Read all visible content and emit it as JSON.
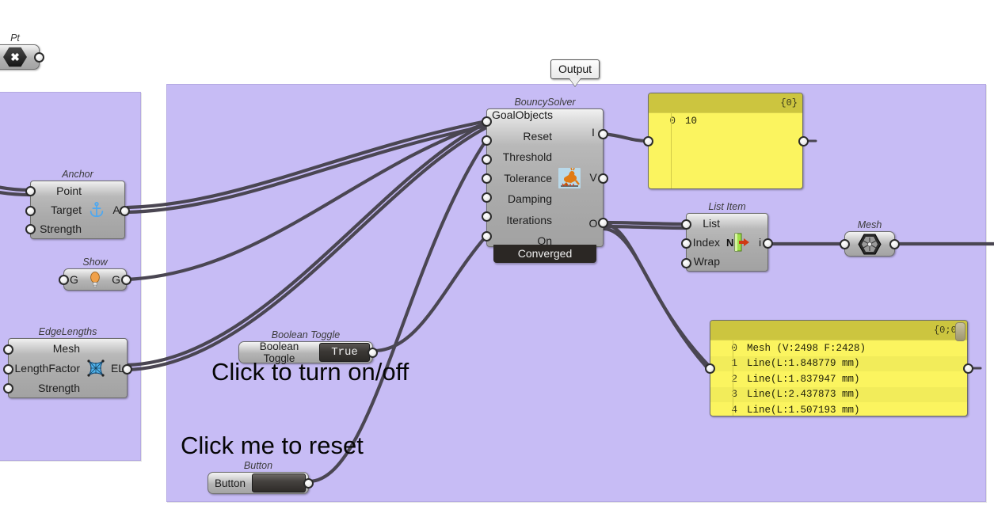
{
  "canvas": {
    "background": "#ffffff",
    "group_color": "#c7bcf5",
    "wire_color": "#4a4652"
  },
  "bubble": {
    "label": "Output"
  },
  "annotations": [
    {
      "text": "Click to turn on/off"
    },
    {
      "text": "Click me to reset"
    }
  ],
  "nodes": {
    "pt": {
      "caption": "Pt",
      "icon": "x-hexagon-icon"
    },
    "anchor": {
      "caption": "Anchor",
      "inputs": [
        "Point",
        "Target",
        "Strength"
      ],
      "outputs": [
        "A"
      ],
      "icon": "anchor-icon"
    },
    "show": {
      "caption": "Show",
      "input_label": "G",
      "output_label": "G",
      "icon": "lightbulb-icon"
    },
    "edgelengths": {
      "caption": "EdgeLengths",
      "inputs": [
        "Mesh",
        "LengthFactor",
        "Strength"
      ],
      "outputs": [
        "EL"
      ],
      "icon": "mesh-grid-icon"
    },
    "bouncysolver": {
      "caption": "BouncySolver",
      "inputs": [
        "GoalObjects",
        "Reset",
        "Threshold",
        "Tolerance",
        "Damping",
        "Iterations",
        "On"
      ],
      "outputs": [
        "I",
        "V",
        "O"
      ],
      "icon": "kangaroo-icon",
      "footer": "Converged"
    },
    "listitem": {
      "caption": "List Item",
      "inputs": [
        "List",
        "Index",
        "Wrap"
      ],
      "outputs": [
        "i"
      ],
      "icon": "list-item-arrow-icon"
    },
    "mesh": {
      "caption": "Mesh",
      "icon": "mesh-hexagon-icon"
    },
    "boolean_toggle": {
      "caption": "Boolean Toggle",
      "label": "Boolean Toggle",
      "value": "True"
    },
    "button": {
      "caption": "Button",
      "label": "Button"
    }
  },
  "panels": {
    "iterations_panel": {
      "path": "{0}",
      "rows": [
        {
          "index": "0",
          "value": "10"
        }
      ]
    },
    "output_panel": {
      "path": "{0;0}",
      "rows": [
        {
          "index": "0",
          "value": "Mesh (V:2498  F:2428)"
        },
        {
          "index": "1",
          "value": "Line(L:1.848779 mm)"
        },
        {
          "index": "2",
          "value": "Line(L:1.837947 mm)"
        },
        {
          "index": "3",
          "value": "Line(L:2.437873 mm)"
        },
        {
          "index": "4",
          "value": "Line(L:1.507193 mm)"
        }
      ]
    }
  }
}
